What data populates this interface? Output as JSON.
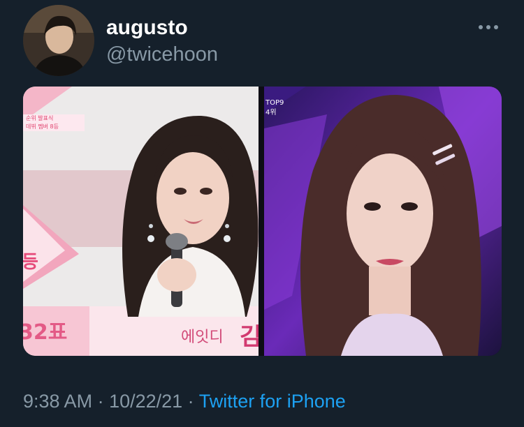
{
  "tweet": {
    "author": {
      "display_name": "augusto",
      "handle": "@twicehoon",
      "avatar_icon": "profile-photo"
    },
    "more_icon": "more-horizontal-icon",
    "media": {
      "left_photo": {
        "caption_line1": "순위 발표식",
        "caption_line2": "데뷔 멤버 8등",
        "rank_glyph": "등",
        "votes": "32표",
        "team_name": "에잇디",
        "name_partial": "김"
      },
      "right_photo": {
        "badge_line1": "TOP9",
        "badge_line2": "4위"
      }
    },
    "timestamp": {
      "time": "9:38 AM",
      "separator1": " · ",
      "date": "10/22/21",
      "separator2": " · ",
      "source": "Twitter for iPhone"
    }
  },
  "colors": {
    "background": "#15202b",
    "name": "#ffffff",
    "secondary_text": "#8899a6",
    "link": "#1da1f2",
    "pink_graphic": "#f4a6c0"
  }
}
